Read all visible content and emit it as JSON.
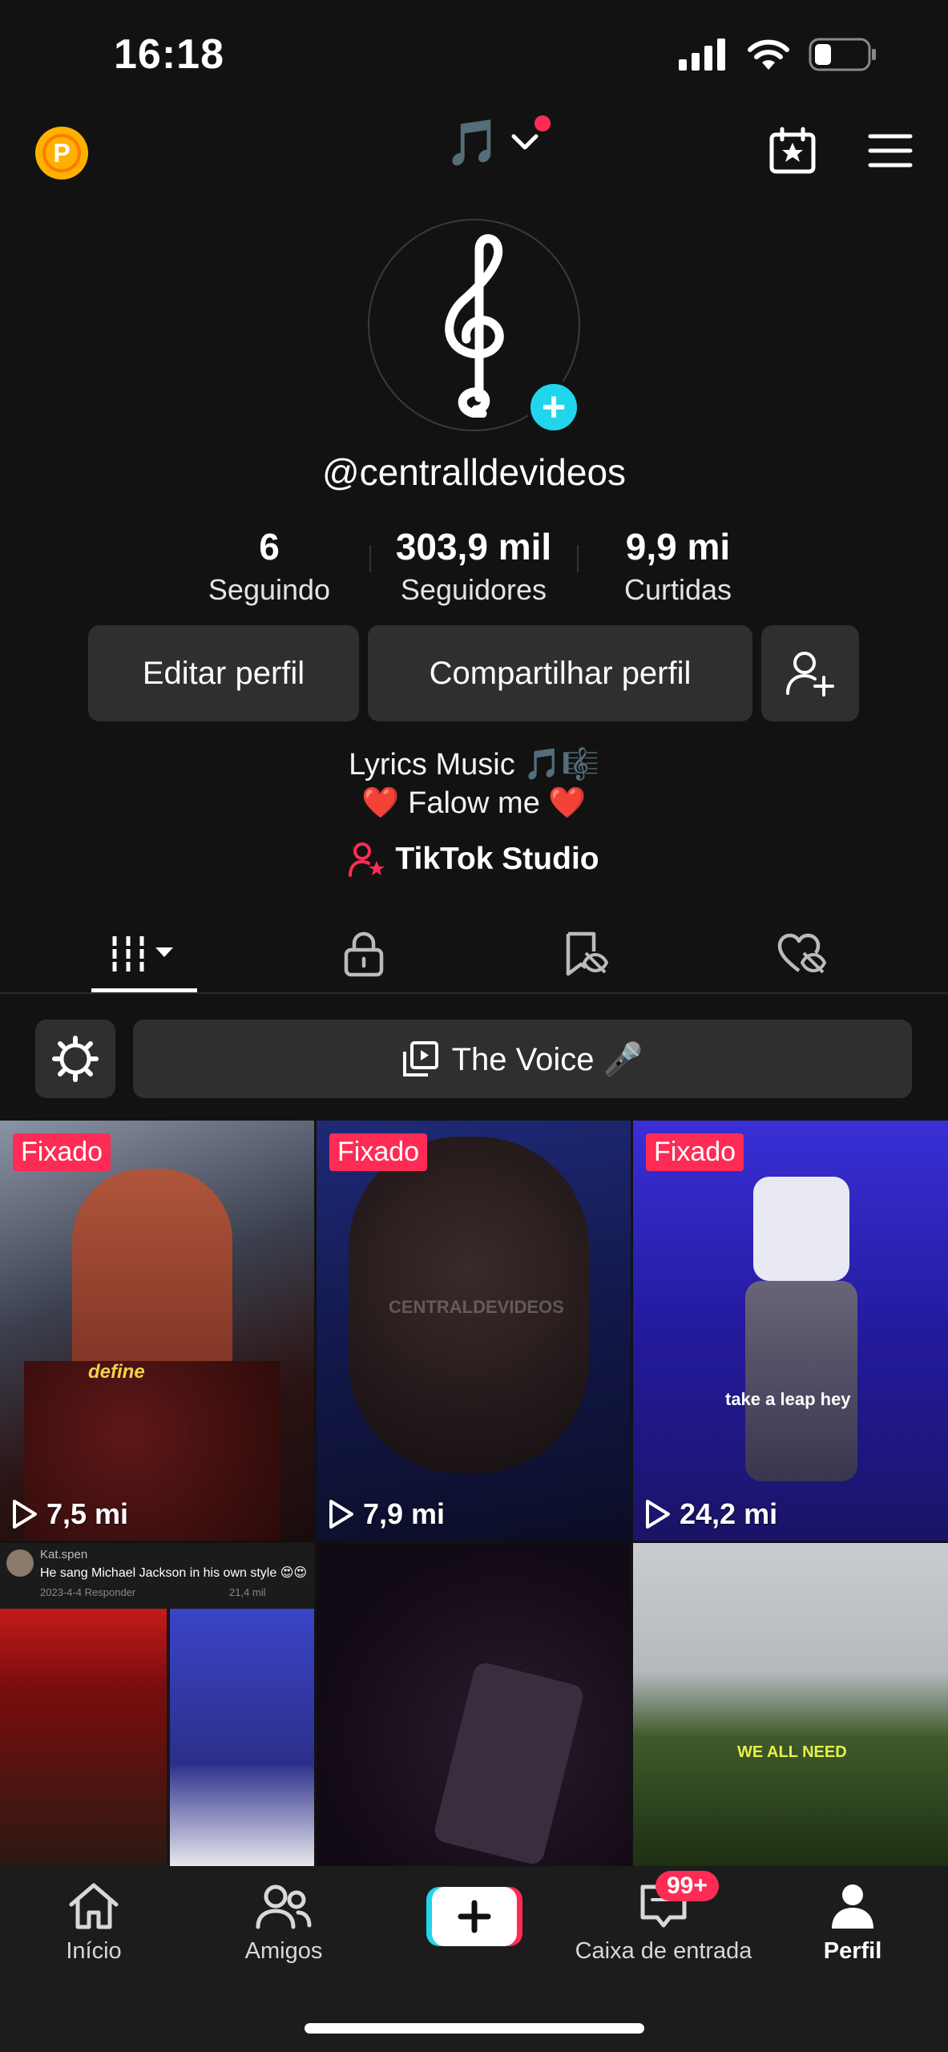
{
  "status_bar": {
    "time": "16:18"
  },
  "top_bar": {
    "icons": [
      "points-badge-icon",
      "music-note-icon",
      "chevron-down-icon",
      "calendar-star-icon",
      "menu-icon"
    ],
    "points_letter": "P"
  },
  "profile": {
    "username": "@centralldevideos",
    "stats": [
      {
        "value": "6",
        "label": "Seguindo"
      },
      {
        "value": "303,9 mil",
        "label": "Seguidores"
      },
      {
        "value": "9,9 mi",
        "label": "Curtidas"
      }
    ],
    "buttons": {
      "edit": "Editar perfil",
      "share": "Compartilhar perfil"
    },
    "bio_line1": "Lyrics Music 🎵🎼",
    "bio_line2": "❤️ Falow me ❤️",
    "studio_label": "TikTok Studio"
  },
  "tabs": [
    "videos-tab",
    "private-tab",
    "favorites-tab",
    "liked-tab"
  ],
  "playlist": {
    "label": "The Voice 🎤"
  },
  "videos": [
    {
      "pinned_label": "Fixado",
      "views": "7,5 mi",
      "caption": "define"
    },
    {
      "pinned_label": "Fixado",
      "views": "7,9 mi",
      "caption": "CENTRALDEVIDEOS"
    },
    {
      "pinned_label": "Fixado",
      "views": "24,2 mi",
      "caption": "take a leap hey"
    },
    {
      "comment_user": "Kat.spen",
      "comment_text": "He sang Michael Jackson in his own style 😍😍",
      "comment_meta": "2023-4-4   Responder",
      "comment_likes": "21,4 mil"
    },
    {
      "caption": ""
    },
    {
      "caption": "WE ALL NEED"
    }
  ],
  "bottom_nav": {
    "items": [
      {
        "label": "Início"
      },
      {
        "label": "Amigos"
      },
      {
        "label": "Caixa de entrada"
      },
      {
        "label": "Perfil"
      }
    ],
    "create_label": "+",
    "inbox_badge": "99+"
  },
  "colors": {
    "accent": "#fe2c55",
    "cyan": "#20d5ec",
    "background": "#121212",
    "button": "#2f2f2f"
  }
}
